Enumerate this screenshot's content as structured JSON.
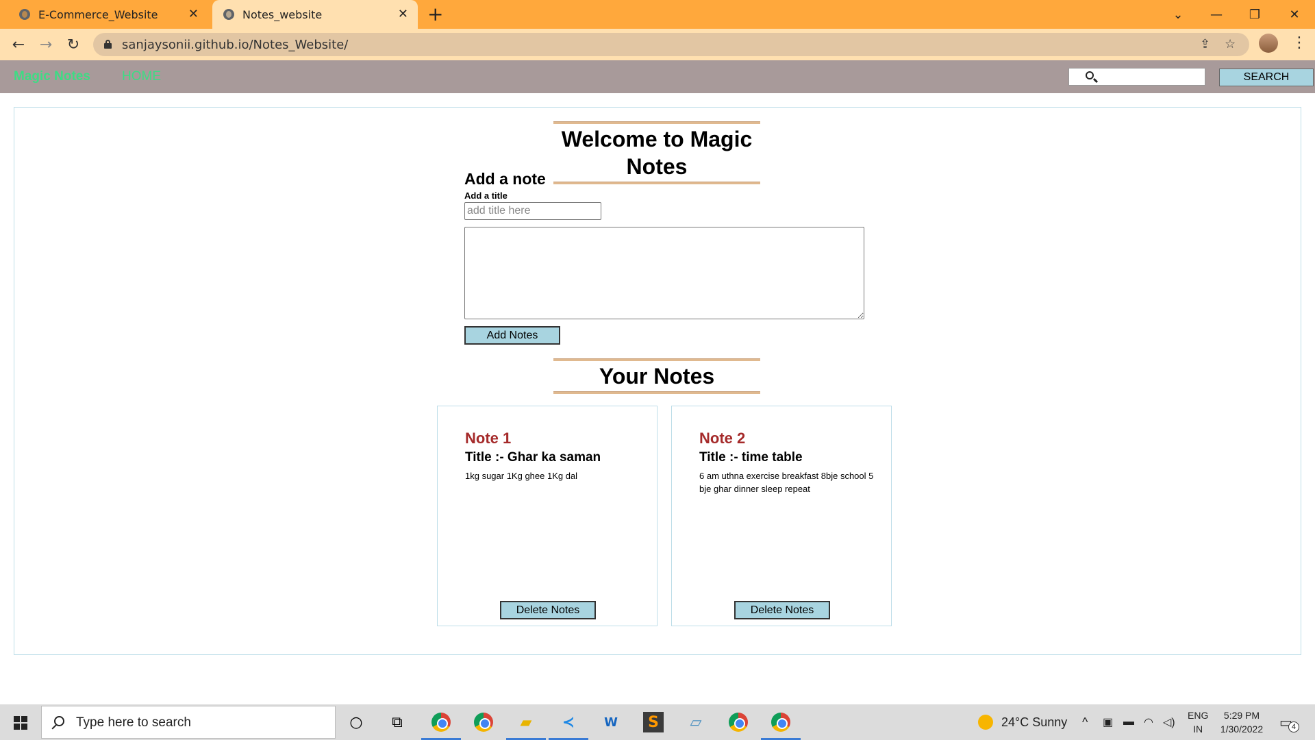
{
  "browser": {
    "tabs": [
      {
        "title": "E-Commerce_Website",
        "active": false
      },
      {
        "title": "Notes_website",
        "active": true
      }
    ],
    "url": "sanjaysonii.github.io/Notes_Website/",
    "accent": "#ffa83c"
  },
  "navbar": {
    "brand": "Magic Notes",
    "home_label": "HOME",
    "search_placeholder": "",
    "search_button": "SEARCH",
    "brand_color": "#3ddc84"
  },
  "main": {
    "heading": "Welcome to Magic Notes",
    "add_note_title": "Add a note",
    "title_label": "Add a title",
    "title_placeholder": "add title here",
    "add_button": "Add Notes",
    "notes_heading": "Your Notes"
  },
  "notes": [
    {
      "number": "Note 1",
      "title": "Title :- Ghar ka saman",
      "text": "1kg sugar 1Kg ghee 1Kg dal",
      "delete_label": "Delete Notes"
    },
    {
      "number": "Note 2",
      "title": "Title :- time table",
      "text": "6 am uthna exercise breakfast 8bje school 5 bje ghar dinner sleep repeat",
      "delete_label": "Delete Notes"
    }
  ],
  "taskbar": {
    "search_placeholder": "Type here to search",
    "weather": "24°C  Sunny",
    "lang_line1": "ENG",
    "lang_line2": "IN",
    "time": "5:29 PM",
    "date": "1/30/2022",
    "notification_count": "4"
  }
}
